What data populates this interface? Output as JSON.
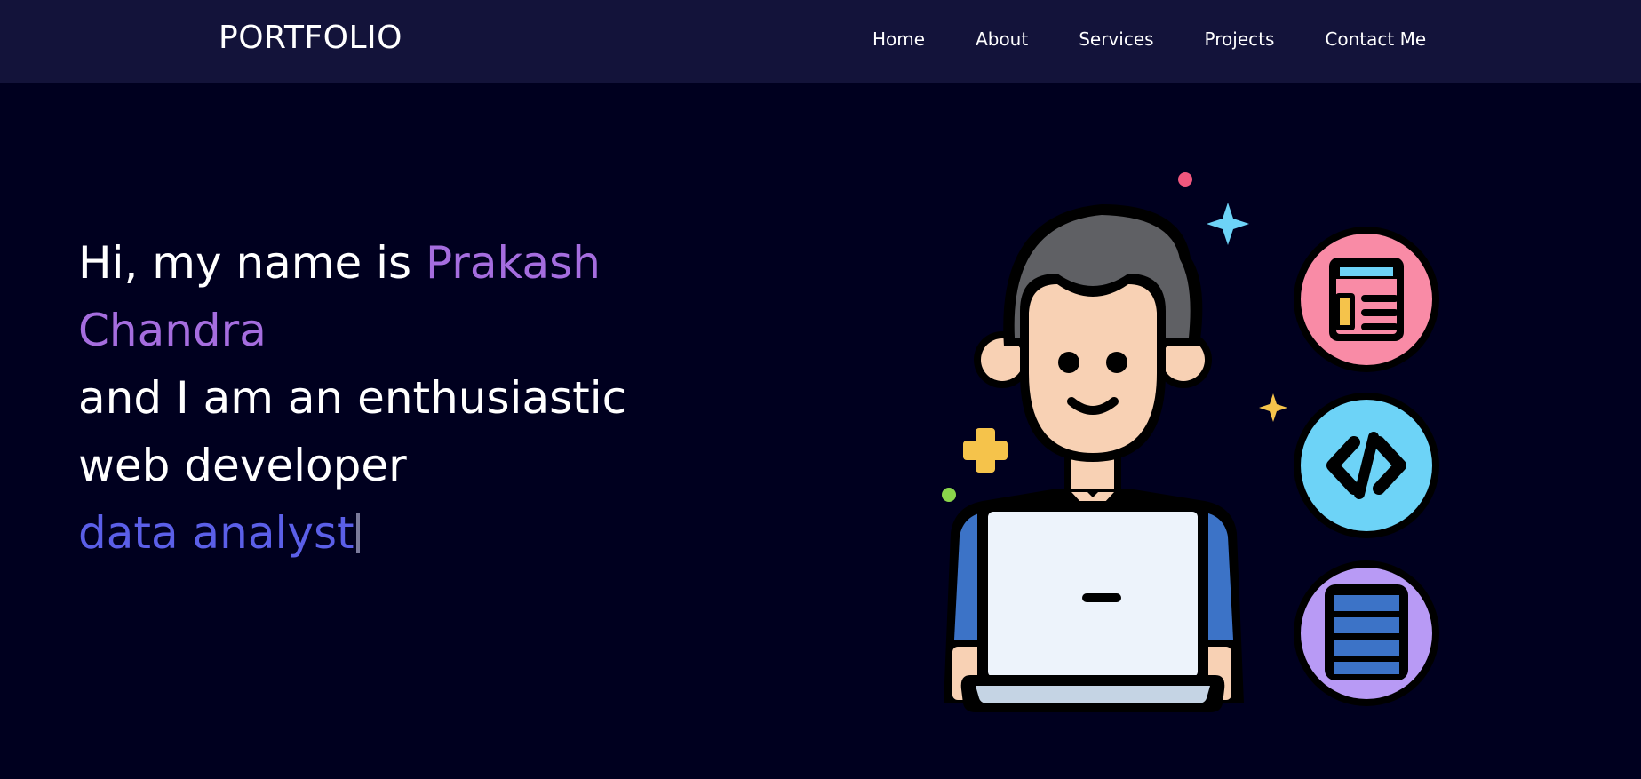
{
  "header": {
    "logo": "PORTFOLIO",
    "nav": [
      "Home",
      "About",
      "Services",
      "Projects",
      "Contact Me"
    ]
  },
  "hero": {
    "intro": "Hi, my name is ",
    "first_name": "Prakash",
    "last_name": "Chandra",
    "line3": "and I am an enthusiastic",
    "line4": "web developer",
    "typed_role": "data analyst"
  },
  "illustration": {
    "icons": [
      "layout-icon",
      "code-icon",
      "database-icon"
    ],
    "colors": {
      "pink": "#f98ba6",
      "cyan": "#6dd3f7",
      "purple": "#b89af5",
      "hair": "#5f6064",
      "skin": "#f8d1b4",
      "shirt": "#3c73c7",
      "laptop": "#edf3fb"
    }
  }
}
